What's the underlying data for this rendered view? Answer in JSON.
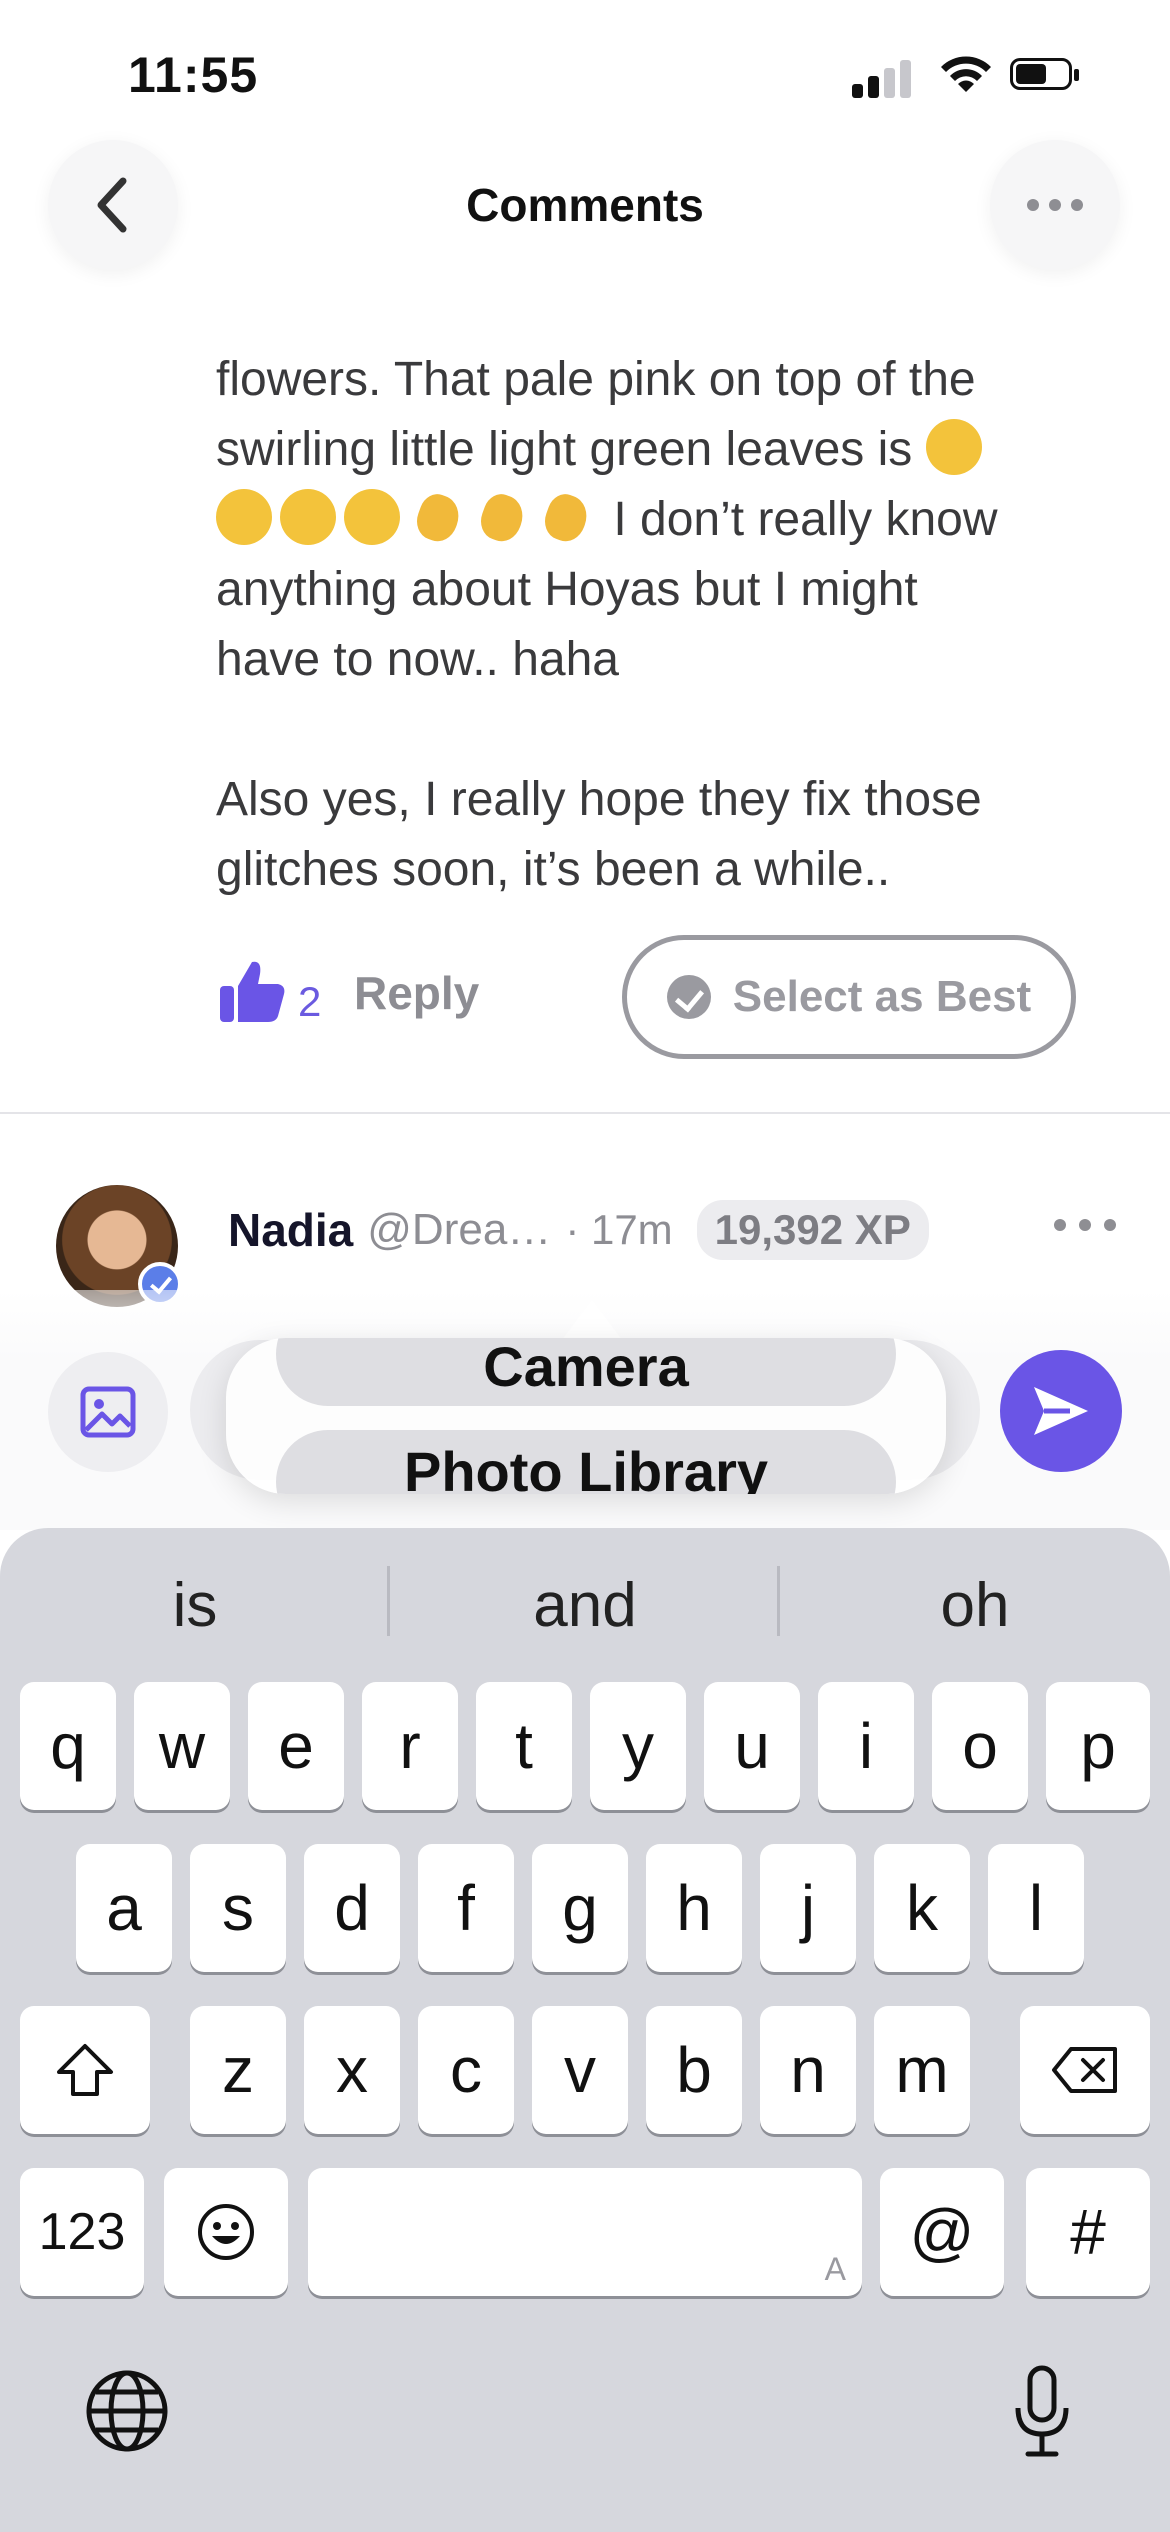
{
  "status": {
    "time": "11:55"
  },
  "header": {
    "title": "Comments"
  },
  "comment": {
    "lines": [
      "flowers. That pale pink on top of the",
      "swirling little light green leaves is",
      "I don’t really know",
      "anything about Hoyas but I might",
      "have to now.. haha",
      "Also yes, I really hope they fix those",
      "glitches soon, it’s been a while.."
    ],
    "like_count": "2",
    "reply_label": "Reply",
    "best_label": "Select as Best"
  },
  "next_comment": {
    "name": "Nadia",
    "handle": "@Drea…",
    "time": "· 17m",
    "xp": "19,392 XP"
  },
  "attach_menu": {
    "camera": "Camera",
    "photo_library": "Photo Library"
  },
  "keyboard": {
    "suggestions": [
      "is",
      "and",
      "oh"
    ],
    "row1": [
      "q",
      "w",
      "e",
      "r",
      "t",
      "y",
      "u",
      "i",
      "o",
      "p"
    ],
    "row2": [
      "a",
      "s",
      "d",
      "f",
      "g",
      "h",
      "j",
      "k",
      "l"
    ],
    "row3": [
      "z",
      "x",
      "c",
      "v",
      "b",
      "n",
      "m"
    ],
    "numbers_key": "123",
    "at_key": "@",
    "hash_key": "#",
    "space_hint": "A"
  }
}
